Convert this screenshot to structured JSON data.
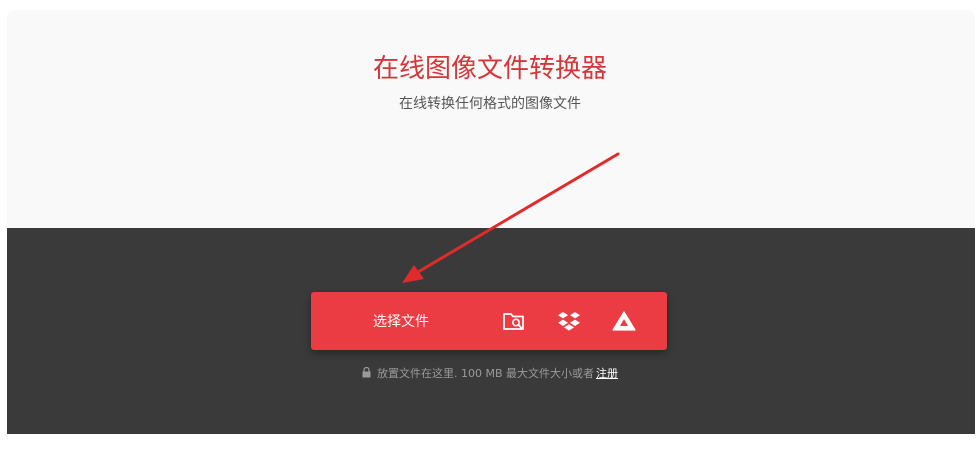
{
  "header": {
    "title": "在线图像文件转换器",
    "subtitle": "在线转换任何格式的图像文件"
  },
  "uploader": {
    "choose_label": "选择文件",
    "sources": [
      {
        "icon": "folder-search-icon"
      },
      {
        "icon": "dropbox-icon"
      },
      {
        "icon": "google-drive-icon"
      }
    ]
  },
  "footer_note": {
    "text": "放置文件在这里. 100 MB 最大文件大小或者",
    "link": "注册"
  },
  "colors": {
    "accent": "#ea3c42",
    "title": "#d4363a",
    "dark_panel": "#3a3a3a",
    "light_panel": "#f9f9f9",
    "annotation_arrow": "#e02b2b"
  }
}
